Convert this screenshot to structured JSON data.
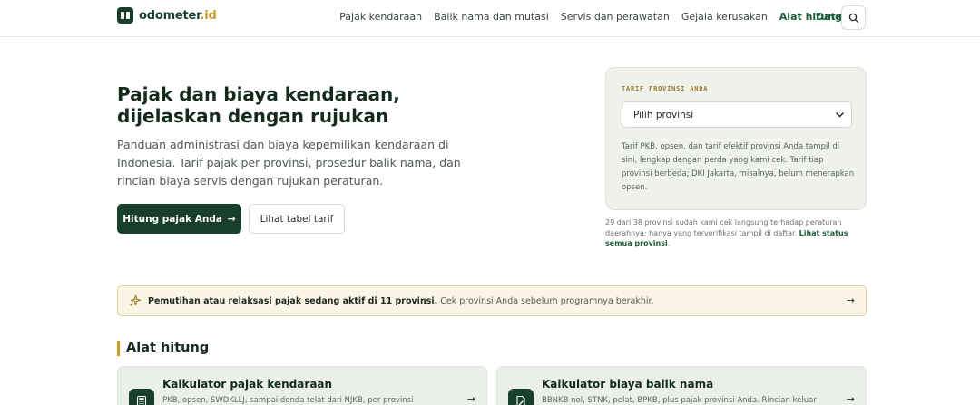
{
  "header": {
    "logo_name": "odometer",
    "logo_tld": ".id",
    "nav": [
      {
        "label": "Pajak kendaraan"
      },
      {
        "label": "Balik nama dan mutasi"
      },
      {
        "label": "Servis dan perawatan"
      },
      {
        "label": "Gejala kerusakan"
      },
      {
        "label": "Alat hitung"
      }
    ],
    "data_link": "Data",
    "search_icon": "search-icon"
  },
  "hero": {
    "title_line1": "Pajak dan biaya kendaraan,",
    "title_line2": "dijelaskan dengan rujukan",
    "description": "Panduan administrasi dan biaya kepemilikan kendaraan di Indonesia. Tarif pajak per provinsi, prosedur balik nama, dan rincian biaya servis dengan rujukan peraturan.",
    "primary_button": "Hitung pajak Anda",
    "primary_arrow": "→",
    "secondary_button": "Lihat tabel tarif"
  },
  "tarif_card": {
    "label": "TARIF PROVINSI ANDA",
    "select_value": "Pilih provinsi",
    "note": "Tarif PKB, opsen, dan tarif efektif provinsi Anda tampil di sini, lengkap dengan perda yang kami cek. Tarif tiap provinsi berbeda; DKI Jakarta, misalnya, belum menerapkan opsen."
  },
  "verify_note": {
    "text": "29 dari 38 provinsi sudah kami cek langsung terhadap peraturan daerahnya; hanya yang terverifikasi tampil di daftar. ",
    "link": "Lihat status semua provinsi",
    "suffix": "."
  },
  "banner": {
    "bold_text": "Pemutihan atau relaksasi pajak sedang aktif di 11 provinsi.",
    "text": " Cek provinsi Anda sebelum programnya berakhir.",
    "arrow": "→"
  },
  "section": {
    "title": "Alat hitung"
  },
  "tools": [
    {
      "title": "Kalkulator pajak kendaraan",
      "desc": "PKB, opsen, SWDKLLJ, sampai denda telat dari NJKB, per provinsi",
      "arrow": "→"
    },
    {
      "title": "Kalkulator biaya balik nama",
      "desc": "BBNKB nol, STNK, pelat, BPKB, plus pajak provinsi Anda. Rincian keluar",
      "arrow": "→"
    }
  ],
  "colors": {
    "brand": "#173f2c",
    "accent": "#c79a2a",
    "banner_bg": "#fbf5e6",
    "card_bg": "#eff2ec"
  }
}
